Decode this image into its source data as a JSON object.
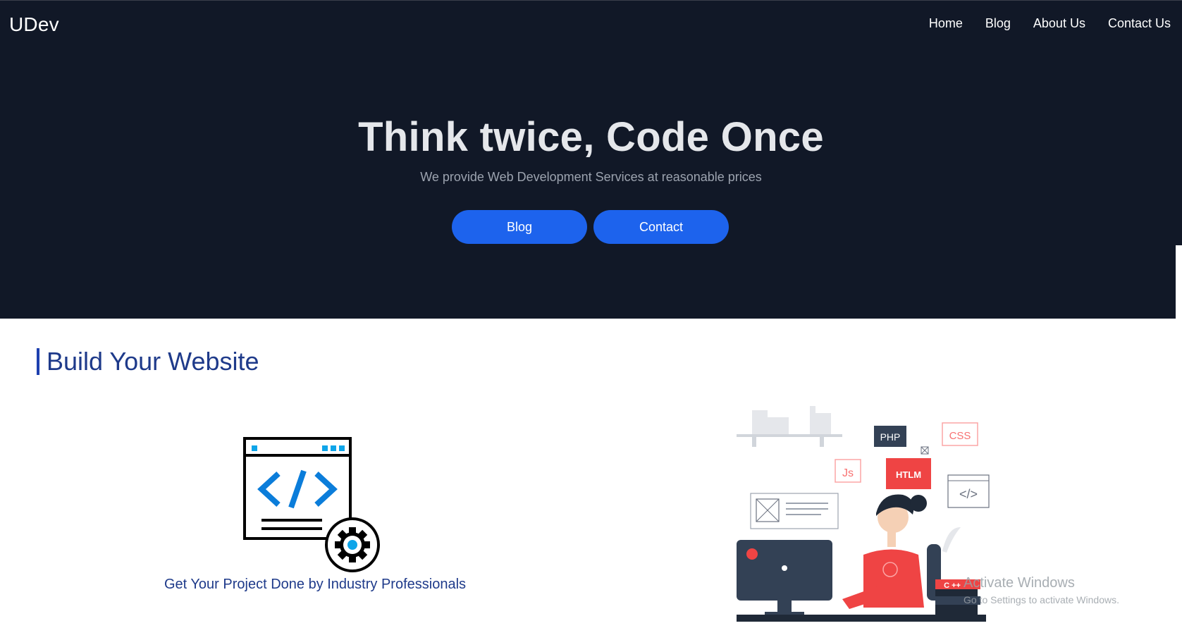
{
  "header": {
    "brand": "UDev",
    "nav": [
      "Home",
      "Blog",
      "About Us",
      "Contact Us"
    ]
  },
  "hero": {
    "title": "Think twice, Code Once",
    "subtitle": "We provide Web Development Services at reasonable prices",
    "buttons": [
      "Blog",
      "Contact"
    ]
  },
  "section": {
    "title": "Build Your Website",
    "caption": "Get Your Project Done by Industry Professionals"
  },
  "illustration": {
    "labels": {
      "php": "PHP",
      "css": "CSS",
      "js": "Js",
      "html": "HTLM",
      "code": "</>",
      "cpp": "C ++"
    }
  },
  "watermark": {
    "line1": "Activate Windows",
    "line2": "Go to Settings to activate Windows."
  },
  "colors": {
    "hero_bg": "#111827",
    "button": "#1d63ed",
    "section_title": "#1e3a8a",
    "accent_red": "#ef4444"
  }
}
